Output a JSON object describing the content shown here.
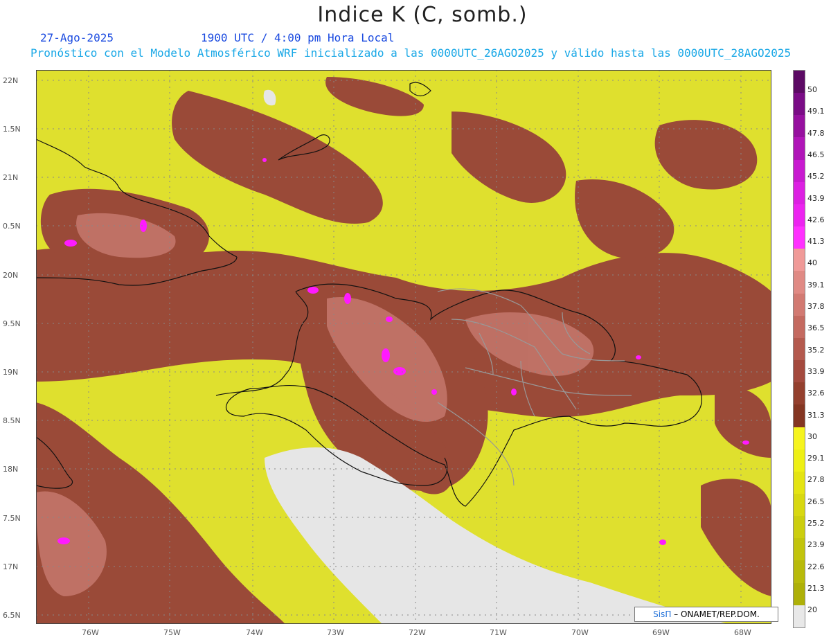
{
  "header": {
    "title": "Indice K (C, somb.)",
    "date": "27-Ago-2025",
    "time": "1900 UTC / 4:00 pm Hora Local",
    "model_line": "Pronóstico con el Modelo Atmosférico WRF inicializado a las 0000UTC_26AGO2025 y válido hasta las  0000UTC_28AGO2025"
  },
  "axes": {
    "lat_labels": [
      "22N",
      "1.5N",
      "21N",
      "0.5N",
      "20N",
      "9.5N",
      "19N",
      "8.5N",
      "18N",
      "7.5N",
      "17N",
      "6.5N"
    ],
    "lon_labels": [
      "76W",
      "75W",
      "74W",
      "73W",
      "72W",
      "71W",
      "70W",
      "69W",
      "68W"
    ]
  },
  "colorbar": {
    "labels": [
      "50",
      "49.1",
      "47.8",
      "46.5",
      "45.2",
      "43.9",
      "42.6",
      "41.3",
      "40",
      "39.1",
      "37.8",
      "36.5",
      "35.2",
      "33.9",
      "32.6",
      "31.3",
      "30",
      "29.1",
      "27.8",
      "26.5",
      "25.2",
      "23.9",
      "22.6",
      "21.3",
      "20"
    ],
    "colors": [
      "#5c0a64",
      "#7a0c86",
      "#96109f",
      "#b015b8",
      "#c81ad0",
      "#dc20e2",
      "#ec24f0",
      "#ff30ff",
      "#f09a98",
      "#e08a84",
      "#d27a72",
      "#c46a60",
      "#b45a4e",
      "#a44a3e",
      "#94402e",
      "#843622",
      "#f6f41e",
      "#eef014",
      "#e4e412",
      "#d8d810",
      "#ccce0e",
      "#c2c40c",
      "#b8ba0a",
      "#aeb008",
      "#e8e8e8"
    ]
  },
  "credit": {
    "brand": "SisΠ",
    "text": " – ONAMET/REP.DOM."
  }
}
